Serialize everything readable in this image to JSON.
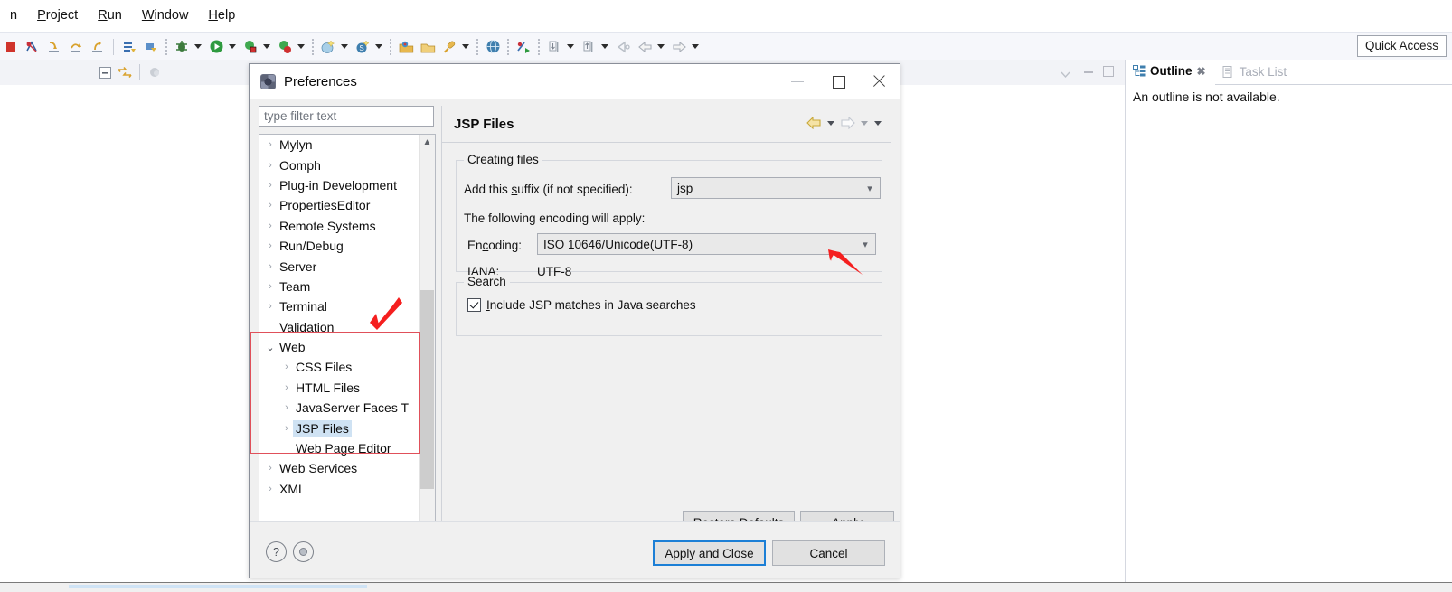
{
  "ide": {
    "menu": [
      {
        "label": "n",
        "mnemonic": ""
      },
      {
        "label": "Project",
        "mnemonic": "P"
      },
      {
        "label": "Run",
        "mnemonic": "R"
      },
      {
        "label": "Window",
        "mnemonic": "W"
      },
      {
        "label": "Help",
        "mnemonic": "H"
      }
    ],
    "quick_access": "Quick Access",
    "toolbar_icons": [
      "terminate-icon",
      "skip-breakpoints-icon",
      "step-into-icon",
      "step-over-icon",
      "step-return-icon",
      "new-wizard-icon",
      "save-icon",
      "debug-icon",
      "run-icon",
      "coverage-icon",
      "profile-icon",
      "new-java-project-icon",
      "new-server-icon",
      "open-type-icon",
      "open-resource-icon",
      "search-icon",
      "web-browser-icon",
      "external-tools-icon",
      "previous-annotation-icon",
      "next-annotation-icon",
      "back-icon",
      "forward-icon"
    ],
    "editor_tab_icons": [
      "collapse-all-icon",
      "link-with-editor-icon",
      "view-menu-icon",
      "minimize-icon",
      "maximize-icon"
    ],
    "outline": {
      "tabs": [
        {
          "label": "Outline",
          "icon": "outline-icon",
          "active": true,
          "closeable": true
        },
        {
          "label": "Task List",
          "icon": "tasklist-icon",
          "active": false,
          "closeable": false
        }
      ],
      "message": "An outline is not available."
    }
  },
  "dialog": {
    "title": "Preferences",
    "icon": "preferences-icon",
    "window_buttons": [
      {
        "name": "minimize-button",
        "glyph": "minimize"
      },
      {
        "name": "maximize-button",
        "glyph": "maximize"
      },
      {
        "name": "close-button",
        "glyph": "close"
      }
    ],
    "filter": {
      "placeholder": "type filter text",
      "value": ""
    },
    "tree": [
      {
        "label": "Mylyn",
        "expander": "collapsed",
        "indent": 0,
        "selected": false
      },
      {
        "label": "Oomph",
        "expander": "collapsed",
        "indent": 0,
        "selected": false
      },
      {
        "label": "Plug-in Development",
        "expander": "collapsed",
        "indent": 0,
        "selected": false
      },
      {
        "label": "PropertiesEditor",
        "expander": "collapsed",
        "indent": 0,
        "selected": false
      },
      {
        "label": "Remote Systems",
        "expander": "collapsed",
        "indent": 0,
        "selected": false
      },
      {
        "label": "Run/Debug",
        "expander": "collapsed",
        "indent": 0,
        "selected": false
      },
      {
        "label": "Server",
        "expander": "collapsed",
        "indent": 0,
        "selected": false
      },
      {
        "label": "Team",
        "expander": "collapsed",
        "indent": 0,
        "selected": false
      },
      {
        "label": "Terminal",
        "expander": "collapsed",
        "indent": 0,
        "selected": false
      },
      {
        "label": "Validation",
        "expander": "none",
        "indent": 0,
        "selected": false
      },
      {
        "label": "Web",
        "expander": "expanded",
        "indent": 0,
        "selected": false
      },
      {
        "label": "CSS Files",
        "expander": "collapsed",
        "indent": 1,
        "selected": false
      },
      {
        "label": "HTML Files",
        "expander": "collapsed",
        "indent": 1,
        "selected": false
      },
      {
        "label": "JavaServer Faces T",
        "expander": "collapsed",
        "indent": 1,
        "selected": false
      },
      {
        "label": "JSP Files",
        "expander": "collapsed",
        "indent": 1,
        "selected": true
      },
      {
        "label": "Web Page Editor",
        "expander": "none",
        "indent": 1,
        "selected": false
      },
      {
        "label": "Web Services",
        "expander": "collapsed",
        "indent": 0,
        "selected": false
      },
      {
        "label": "XML",
        "expander": "collapsed",
        "indent": 0,
        "selected": false
      }
    ],
    "page": {
      "title": "JSP Files",
      "nav_icons": [
        "back-arrow-icon",
        "back-dropdown-icon",
        "forward-arrow-icon",
        "forward-dropdown-icon",
        "view-menu-icon"
      ],
      "creating_group": {
        "legend": "Creating files",
        "suffix_label": "Add this suffix (if not specified):",
        "suffix_mnemonic": "s",
        "suffix_value": "jsp",
        "encoding_note": "The following encoding will apply:",
        "encoding_label": "Encoding:",
        "encoding_mnemonic": "c",
        "encoding_value": "ISO 10646/Unicode(UTF-8)",
        "iana_label": "IANA:",
        "iana_value": "UTF-8"
      },
      "search_group": {
        "legend": "Search",
        "checkbox_label": "Include JSP matches in Java searches",
        "checkbox_mnemonic": "I",
        "checked": true
      },
      "restore_defaults_label": "Restore Defaults",
      "restore_defaults_mnemonic": "D",
      "apply_label": "Apply",
      "apply_mnemonic": "A"
    },
    "footer": {
      "help_icon": "help-icon",
      "about_icon": "about-icon",
      "apply_and_close_label": "Apply and Close",
      "cancel_label": "Cancel"
    }
  },
  "annotations": {
    "highlight_color": "#e0505a",
    "arrow_color": "#f51f1f",
    "arrows": [
      {
        "name": "annotation-arrow-tree",
        "target": "web-tree-node"
      },
      {
        "name": "annotation-arrow-encoding",
        "target": "encoding-combo"
      }
    ],
    "rects": [
      {
        "name": "annotation-rect-web-subtree",
        "target": "web-subtree"
      }
    ]
  }
}
